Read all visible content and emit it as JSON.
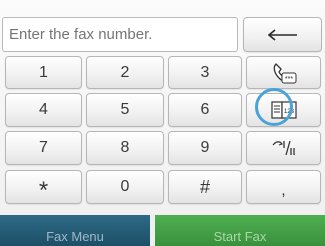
{
  "fax_entry": {
    "placeholder": "Enter the fax number."
  },
  "keypad": {
    "keys": [
      "1",
      "2",
      "3",
      "4",
      "5",
      "6",
      "7",
      "8",
      "9",
      "*",
      "0",
      "#",
      ","
    ]
  },
  "side_buttons": {
    "backspace_icon": "backspace-arrow-icon",
    "speed_dial_icon": "speed-dial-icon",
    "phonebook_icon": "fax-phonebook-icon",
    "redial_pause_icon": "redial-pause-icon"
  },
  "bottom_bar": {
    "fax_menu_label": "Fax Menu",
    "start_fax_label": "Start Fax"
  },
  "colors": {
    "highlight_ring": "#4aa3d8",
    "fax_menu_bg": "#1d4f67",
    "start_fax_bg": "#3a913c"
  }
}
